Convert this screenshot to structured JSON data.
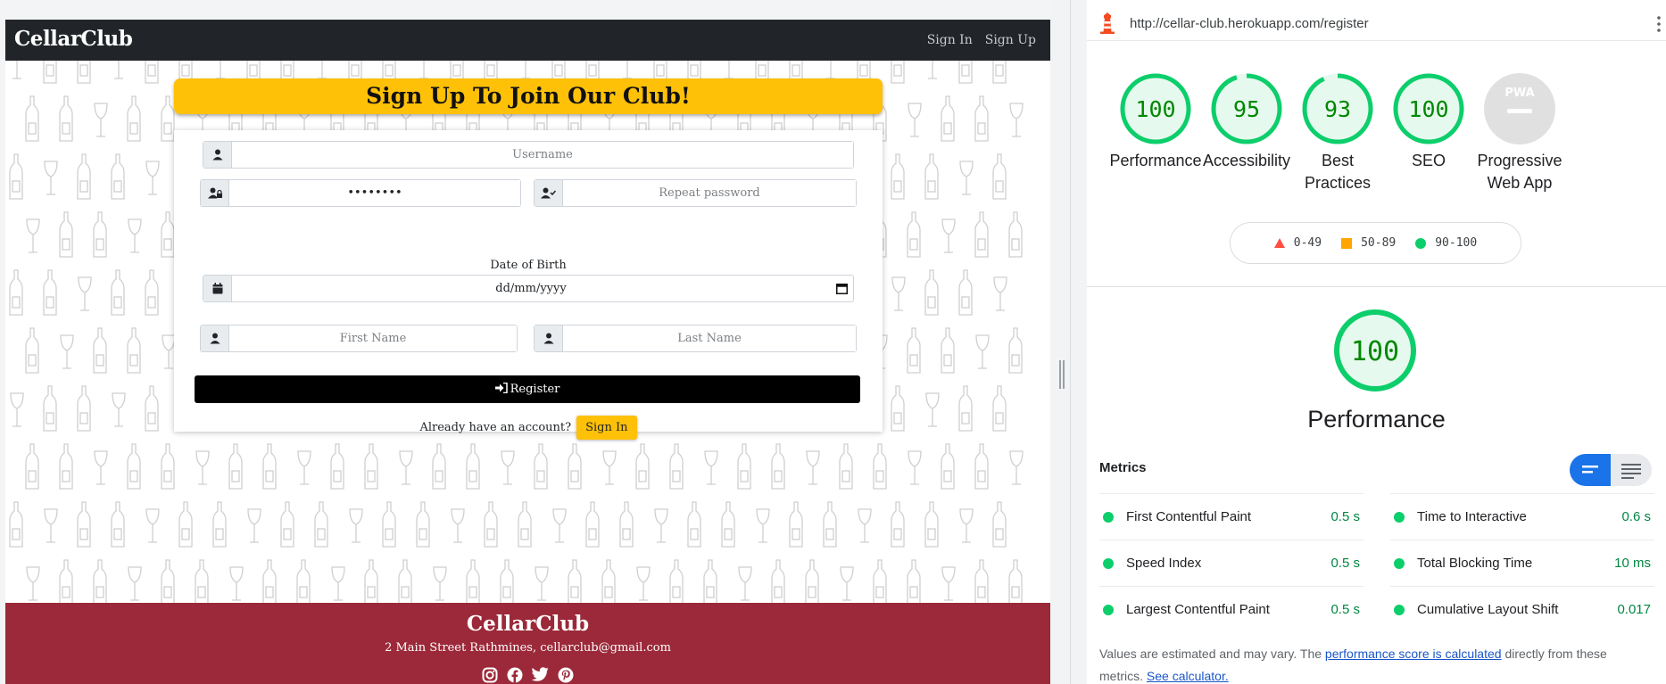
{
  "site": {
    "brand": "CellarClub",
    "nav": {
      "signin": "Sign In",
      "signup": "Sign Up"
    },
    "banner_title": "Sign Up To Join Our Club!",
    "form": {
      "username_placeholder": "Username",
      "password_value": "••••••••",
      "repeat_password_placeholder": "Repeat password",
      "dob_label": "Date of Birth",
      "dob_value": "dd/mm/yyyy",
      "first_name_placeholder": "First Name",
      "last_name_placeholder": "Last Name",
      "register_label": "Register",
      "already_text": "Already have an account?",
      "signin_button": "Sign In"
    },
    "footer": {
      "brand": "CellarClub",
      "address": "2 Main Street Rathmines,  cellarclub@gmail.com"
    }
  },
  "lighthouse": {
    "url": "http://cellar-club.herokuapp.com/register",
    "colors": {
      "pass": "#0cce6b",
      "pass_text": "#008800",
      "average": "#ffa400",
      "fail": "#ff4e42"
    },
    "categories": [
      {
        "label": "Performance",
        "score": "100",
        "fraction": 1.0
      },
      {
        "label": "Accessibility",
        "score": "95",
        "fraction": 0.95
      },
      {
        "label": "Best Practices",
        "score": "93",
        "fraction": 0.93
      },
      {
        "label": "SEO",
        "score": "100",
        "fraction": 1.0
      },
      {
        "label": "Progressive Web App",
        "score": "PWA",
        "fraction": 0
      }
    ],
    "legend": [
      {
        "range": "0-49",
        "shape": "triangle",
        "color": "#ff4e42"
      },
      {
        "range": "50-89",
        "shape": "square",
        "color": "#ffa400"
      },
      {
        "range": "90-100",
        "shape": "circle",
        "color": "#0cce6b"
      }
    ],
    "main_score": "100",
    "main_label": "Performance",
    "metrics_title": "Metrics",
    "metrics": [
      {
        "label": "First Contentful Paint",
        "value": "0.5 s"
      },
      {
        "label": "Time to Interactive",
        "value": "0.6 s"
      },
      {
        "label": "Speed Index",
        "value": "0.5 s"
      },
      {
        "label": "Total Blocking Time",
        "value": "10 ms"
      },
      {
        "label": "Largest Contentful Paint",
        "value": "0.5 s"
      },
      {
        "label": "Cumulative Layout Shift",
        "value": "0.017"
      }
    ],
    "note": {
      "prefix": "Values are estimated and may vary. The ",
      "link1": "performance score is calculated",
      "middle": " directly from these metrics. ",
      "link2": "See calculator."
    }
  }
}
